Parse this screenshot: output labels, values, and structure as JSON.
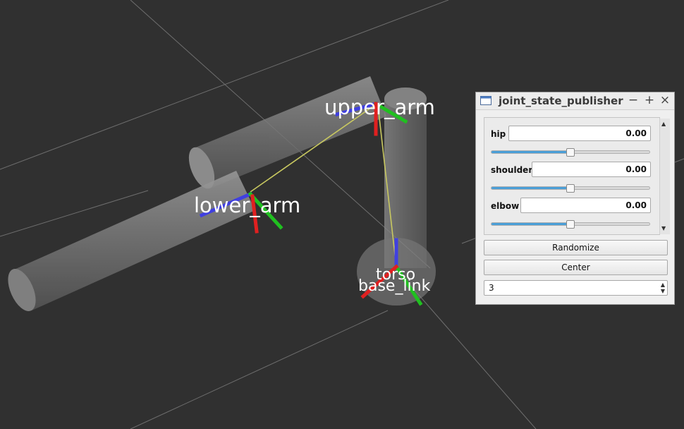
{
  "scene": {
    "frames": {
      "upper_arm": "upper_arm",
      "lower_arm": "lower_arm",
      "torso": "torso",
      "base_link": "base_link"
    }
  },
  "window": {
    "title": "joint_state_publisher",
    "minimize": "−",
    "maximize": "+",
    "close": "×"
  },
  "joints": [
    {
      "name": "hip",
      "value": "0.00",
      "position": 0.5
    },
    {
      "name": "shoulder",
      "value": "0.00",
      "position": 0.5
    },
    {
      "name": "elbow",
      "value": "0.00",
      "position": 0.5
    }
  ],
  "buttons": {
    "randomize": "Randomize",
    "center": "Center"
  },
  "spinbox": {
    "value": "3"
  },
  "colors": {
    "background": "#303030",
    "grid": "#6e6e6e",
    "x_axis": "#e02020",
    "y_axis": "#20c020",
    "z_axis": "#4040e0",
    "tf_link": "#c8c860",
    "slider_fill": "#4a9fd8"
  }
}
